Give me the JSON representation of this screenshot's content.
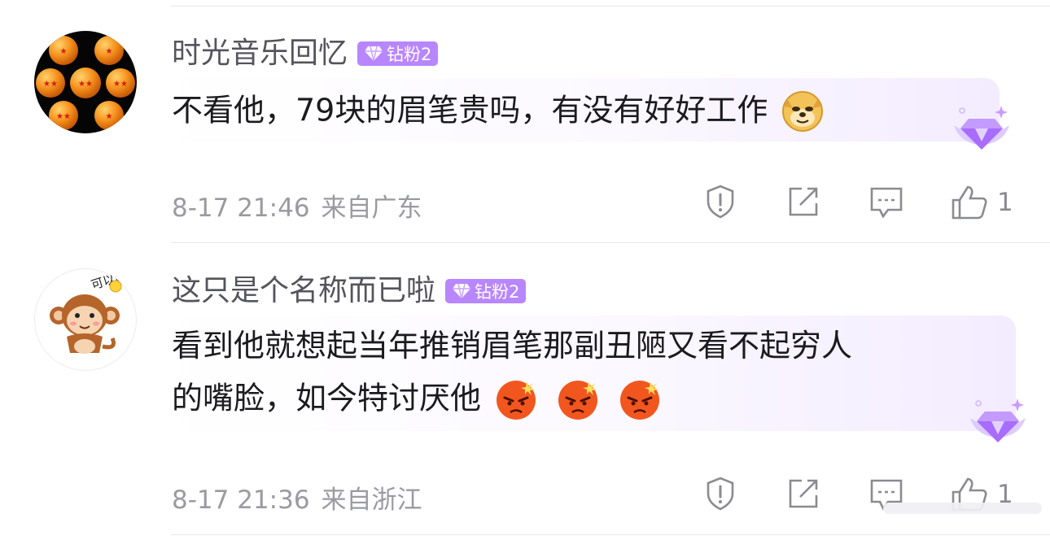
{
  "comments": [
    {
      "username": "时光音乐回忆",
      "badge": "钻粉2",
      "text": "不看他，79块的眉笔贵吗，有没有好好工作",
      "emojis": [
        "doge-emoji"
      ],
      "date": "8-17 21:46",
      "location": "来自广东",
      "likes": "1"
    },
    {
      "username": "这只是个名称而已啦",
      "badge": "钻粉2",
      "text_line1": "看到他就想起当年推销眉笔那副丑陋又看不起穷人",
      "text_line2": "的嘴脸，如今特讨厌他",
      "emojis": [
        "angry-emoji",
        "angry-emoji",
        "angry-emoji"
      ],
      "date": "8-17 21:36",
      "location": "来自浙江",
      "likes": "1"
    }
  ],
  "colors": {
    "badge": "#b886ff",
    "text": "#1b1b1f",
    "username": "#54545c",
    "meta": "#9a9aa2"
  },
  "icons": [
    "report-icon",
    "share-icon",
    "reply-icon",
    "like-icon"
  ]
}
